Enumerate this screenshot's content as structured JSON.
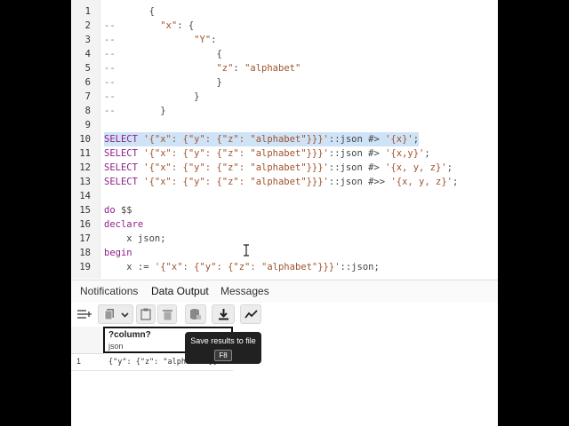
{
  "editor": {
    "lines": [
      {
        "num": "1",
        "parts": [
          {
            "c": "op",
            "t": "        {"
          }
        ]
      },
      {
        "num": "2",
        "parts": [
          {
            "c": "cm",
            "t": "--"
          },
          {
            "c": "op",
            "t": "        "
          },
          {
            "c": "str",
            "t": "\"x\""
          },
          {
            "c": "op",
            "t": ": {"
          }
        ]
      },
      {
        "num": "3",
        "parts": [
          {
            "c": "cm",
            "t": "--"
          },
          {
            "c": "op",
            "t": "              "
          },
          {
            "c": "str",
            "t": "\"Y\""
          },
          {
            "c": "op",
            "t": ":"
          }
        ]
      },
      {
        "num": "4",
        "parts": [
          {
            "c": "cm",
            "t": "--"
          },
          {
            "c": "op",
            "t": "                  {"
          }
        ]
      },
      {
        "num": "5",
        "parts": [
          {
            "c": "cm",
            "t": "--"
          },
          {
            "c": "op",
            "t": "                  "
          },
          {
            "c": "str",
            "t": "\"z\""
          },
          {
            "c": "op",
            "t": ": "
          },
          {
            "c": "str",
            "t": "\"alphabet\""
          }
        ]
      },
      {
        "num": "6",
        "parts": [
          {
            "c": "cm",
            "t": "--"
          },
          {
            "c": "op",
            "t": "                  }"
          }
        ]
      },
      {
        "num": "7",
        "parts": [
          {
            "c": "cm",
            "t": "--"
          },
          {
            "c": "op",
            "t": "              }"
          }
        ]
      },
      {
        "num": "8",
        "parts": [
          {
            "c": "cm",
            "t": "--"
          },
          {
            "c": "op",
            "t": "        }"
          }
        ]
      },
      {
        "num": "9",
        "parts": []
      },
      {
        "num": "10",
        "highlight": true,
        "parts": [
          {
            "c": "kw",
            "t": "SELECT"
          },
          {
            "c": "op",
            "t": " "
          },
          {
            "c": "str",
            "t": "'{\"x\": {\"y\": {\"z\": \"alphabet\"}}}'"
          },
          {
            "c": "op",
            "t": "::json #> "
          },
          {
            "c": "str",
            "t": "'{x}'"
          },
          {
            "c": "op",
            "t": ";"
          }
        ]
      },
      {
        "num": "11",
        "parts": [
          {
            "c": "kw",
            "t": "SELECT"
          },
          {
            "c": "op",
            "t": " "
          },
          {
            "c": "str",
            "t": "'{\"x\": {\"y\": {\"z\": \"alphabet\"}}}'"
          },
          {
            "c": "op",
            "t": "::json #> "
          },
          {
            "c": "str",
            "t": "'{x,y}'"
          },
          {
            "c": "op",
            "t": ";"
          }
        ]
      },
      {
        "num": "12",
        "parts": [
          {
            "c": "kw",
            "t": "SELECT"
          },
          {
            "c": "op",
            "t": " "
          },
          {
            "c": "str",
            "t": "'{\"x\": {\"y\": {\"z\": \"alphabet\"}}}'"
          },
          {
            "c": "op",
            "t": "::json #> "
          },
          {
            "c": "str",
            "t": "'{x, y, z}'"
          },
          {
            "c": "op",
            "t": ";"
          }
        ]
      },
      {
        "num": "13",
        "parts": [
          {
            "c": "kw",
            "t": "SELECT"
          },
          {
            "c": "op",
            "t": " "
          },
          {
            "c": "str",
            "t": "'{\"x\": {\"y\": {\"z\": \"alphabet\"}}}'"
          },
          {
            "c": "op",
            "t": "::json #>> "
          },
          {
            "c": "str",
            "t": "'{x, y, z}'"
          },
          {
            "c": "op",
            "t": ";"
          }
        ]
      },
      {
        "num": "14",
        "parts": []
      },
      {
        "num": "15",
        "parts": [
          {
            "c": "kw",
            "t": "do"
          },
          {
            "c": "op",
            "t": " $$"
          }
        ]
      },
      {
        "num": "16",
        "parts": [
          {
            "c": "kw",
            "t": "declare"
          }
        ]
      },
      {
        "num": "17",
        "parts": [
          {
            "c": "op",
            "t": "    x json;"
          }
        ]
      },
      {
        "num": "18",
        "parts": [
          {
            "c": "kw",
            "t": "begin"
          }
        ]
      },
      {
        "num": "19",
        "parts": [
          {
            "c": "op",
            "t": "    x := "
          },
          {
            "c": "str",
            "t": "'{\"x\": {\"y\": {\"z\": \"alphabet\"}}}'"
          },
          {
            "c": "op",
            "t": "::json;"
          }
        ]
      }
    ]
  },
  "tabs": [
    {
      "label": "Notifications",
      "active": false
    },
    {
      "label": "Data Output",
      "active": true
    },
    {
      "label": "Messages",
      "active": false
    }
  ],
  "toolbar": {
    "icons": [
      "add-row-icon",
      "copy-icon",
      "chevron-down-icon",
      "paste-icon",
      "delete-icon",
      "save-data-icon",
      "download-icon",
      "graph-icon"
    ]
  },
  "grid": {
    "column": {
      "name": "?column?",
      "type": "json"
    },
    "rows": [
      {
        "num": "1",
        "value": "{\"y\": {\"z\": \"alphabet\"}}"
      }
    ]
  },
  "tooltip": {
    "text": "Save results to file",
    "shortcut": "F8"
  }
}
